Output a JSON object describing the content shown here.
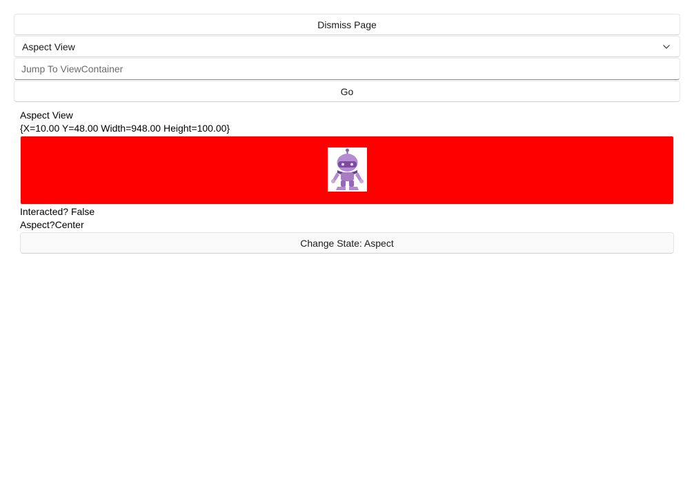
{
  "toolbar": {
    "dismiss_label": "Dismiss Page",
    "combo_value": "Aspect View",
    "jump_placeholder": "Jump To ViewContainer",
    "go_label": "Go"
  },
  "content": {
    "title": "Aspect View",
    "bounds_text": "{X=10.00 Y=48.00 Width=948.00 Height=100.00}",
    "interacted_text": "Interacted? False",
    "aspect_text": "Aspect?Center",
    "change_state_label": "Change State: Aspect"
  },
  "colors": {
    "aspect_background": "#ff0000",
    "bot_color": "#a77dc2"
  },
  "icons": {
    "dropdown": "chevron-down-icon",
    "image": "dotnet-bot-image"
  }
}
